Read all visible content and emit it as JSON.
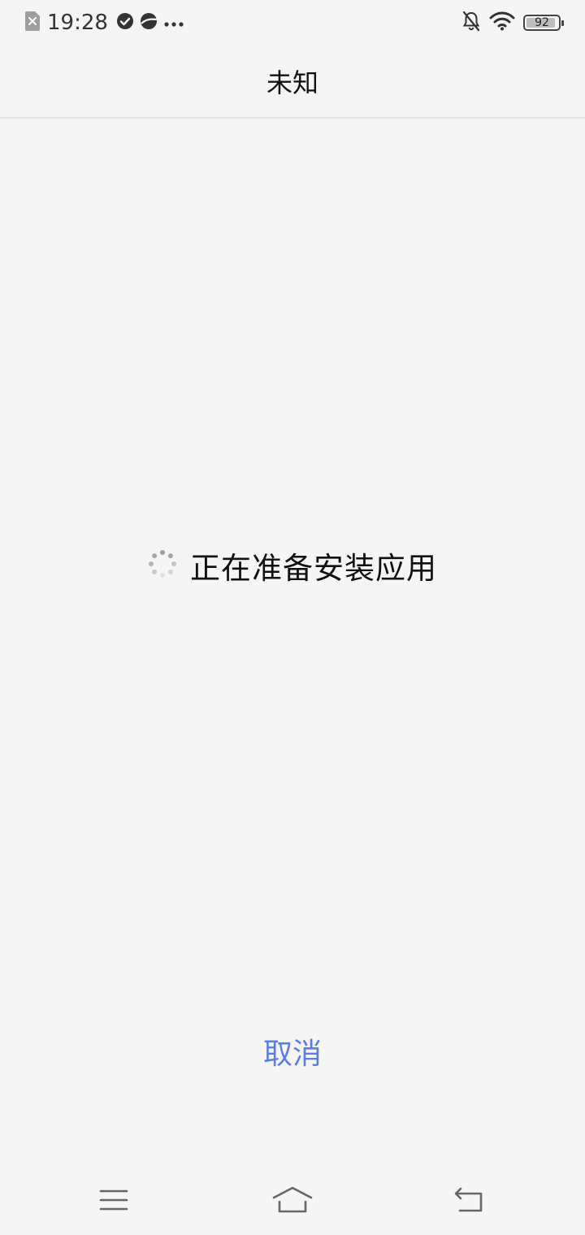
{
  "status_bar": {
    "time": "19:28",
    "battery_level": "92",
    "battery_fraction": 0.92,
    "icons": [
      "sim-error-icon",
      "check-circle-icon",
      "browser-icon",
      "more-dots-icon",
      "bell-off-icon",
      "wifi-icon",
      "battery-icon"
    ]
  },
  "header": {
    "title": "未知"
  },
  "main": {
    "loading_text": "正在准备安装应用",
    "spinner_icon": "spinner-icon"
  },
  "footer": {
    "cancel_label": "取消"
  },
  "nav_bar": {
    "icons": [
      "menu-icon",
      "home-icon",
      "back-icon"
    ]
  },
  "colors": {
    "background": "#f5f5f5",
    "accent": "#5b7ee5",
    "divider": "#e6e6e6",
    "text": "#111111"
  }
}
